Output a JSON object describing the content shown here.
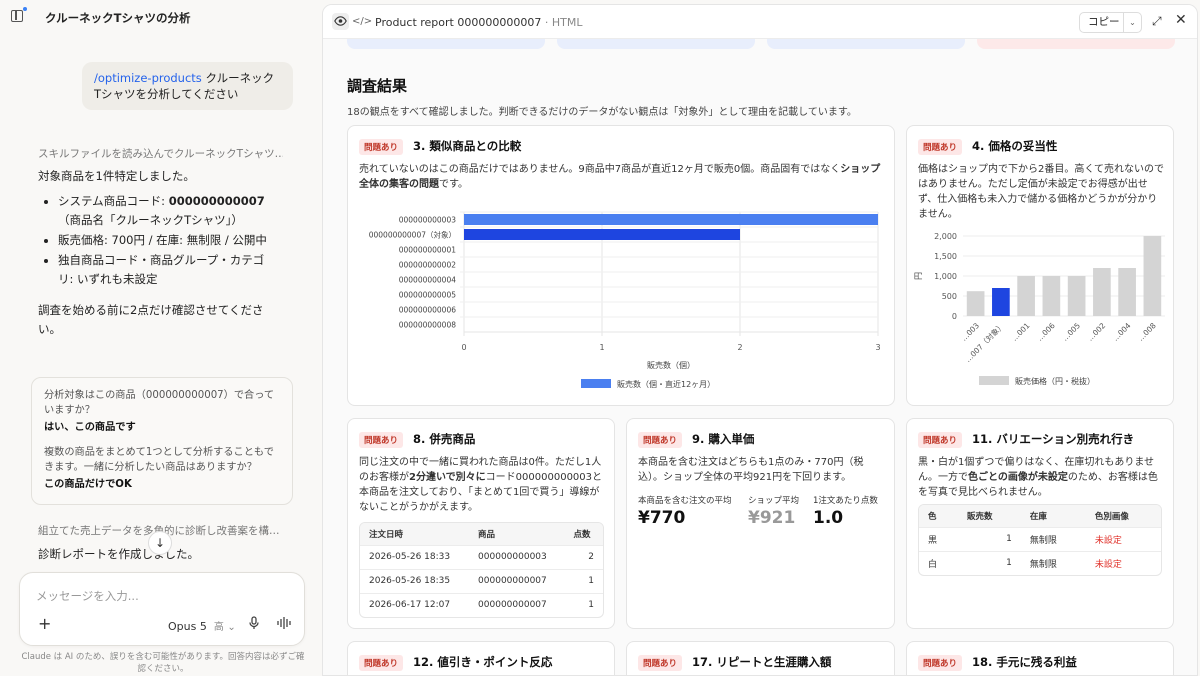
{
  "chat": {
    "title": "クルーネックTシャツの分析",
    "user_command": "/optimize-products",
    "user_text": " クルーネックTシャツを分析してください",
    "collapsed_1": "スキルファイルを読み込んでクルーネックTシャツ…",
    "intro": "対象商品を1件特定しました。",
    "b1_prefix": "システム商品コード: ",
    "b1_code": "000000000007",
    "b1_name": "（商品名「クルーネックTシャツ」）",
    "b2": "販売価格: 700円 / 在庫: 無制限 / 公開中",
    "b3": "独自商品コード・商品グループ・カテゴリ: いずれも未設定",
    "confirm": "調査を始める前に2点だけ確認させてください。",
    "q1": "分析対象はこの商品（000000000007）で合っていますか？",
    "a1": "はい、この商品です",
    "q2": "複数の商品をまとめて1つとして分析することもできます。一緒に分析したい商品はありますか？",
    "a2": "この商品だけでOK",
    "collapsed_2": "組立てた売上データを多角的に診断し改善案を構…",
    "report_done": "診断レポートを作成しました。",
    "scroll_icon": "↓",
    "placeholder": "メッセージを入力...",
    "plus_icon": "+",
    "model": "Opus 5",
    "model_level": "高",
    "mic_icon": "mic-icon",
    "voice_icon": "voice-icon",
    "disclaimer": "Claude は AI のため、誤りを含む可能性があります。回答内容は必ずご確認ください。"
  },
  "artifact": {
    "title": "Product report 000000000007",
    "title_type": " · HTML",
    "copy_label": "コピー",
    "strip_colors": [
      "#e8eefc",
      "#e8eefc",
      "#e8eefc",
      "#fde9e9"
    ],
    "section_title": "調査結果",
    "section_desc": "18の観点をすべて確認しました。判断できるだけのデータがない観点は「対象外」として理由を記載しています。",
    "badge": "問題あり",
    "card3": {
      "title": "3. 類似商品との比較",
      "body_1": "売れていないのはこの商品だけではありません。9商品中7商品が直近12ヶ月で販売0個。商品固有ではなく",
      "body_bold": "ショップ全体の集客の問題",
      "body_2": "です。"
    },
    "card4": {
      "title": "4. 価格の妥当性",
      "body": "価格はショップ内で下から2番目。高くて売れないのではありません。ただし定価が未設定でお得感が出せず、仕入価格も未入力で儲かる価格かどうかが分かりません。"
    },
    "card8": {
      "title": "8. 併売商品",
      "body_1": "同じ注文の中で一緒に買われた商品は0件。ただし1人のお客様が",
      "body_bold": "2分違いで別々に",
      "body_2": "コード000000000003と本商品を注文しており、「まとめて1回で買う」導線がないことがうかがえます。",
      "headers": [
        "注文日時",
        "商品",
        "点数"
      ],
      "rows": [
        [
          "2026-05-26 18:33",
          "000000000003",
          "2"
        ],
        [
          "2026-05-26 18:35",
          "000000000007",
          "1"
        ],
        [
          "2026-06-17 12:07",
          "000000000007",
          "1"
        ]
      ]
    },
    "card9": {
      "title": "9. 購入単価",
      "body": "本商品を含む注文はどちらも1点のみ・770円（税込）。ショップ全体の平均921円を下回ります。",
      "m1_label": "本商品を含む注文の平均",
      "m1_value": "¥770",
      "m2_label": "ショップ平均",
      "m2_value": "¥921",
      "m3_label": "1注文あたり点数",
      "m3_value": "1.0"
    },
    "card11": {
      "title": "11. バリエーション別売れ行き",
      "body_1": "黒・白が1個ずつで偏りはなく、在庫切れもありません。一方で",
      "body_bold": "色ごとの画像が未設定",
      "body_2": "のため、お客様は色を写真で見比べられません。",
      "headers": [
        "色",
        "販売数",
        "在庫",
        "色別画像"
      ],
      "rows": [
        [
          "黒",
          "1",
          "無制限",
          "未設定"
        ],
        [
          "白",
          "1",
          "無制限",
          "未設定"
        ]
      ]
    },
    "card12": {
      "title": "12. 値引き・ポイント反応"
    },
    "card17": {
      "title": "17. リピートと生涯購入額"
    },
    "card18": {
      "title": "18. 手元に残る利益"
    }
  },
  "chart_data": [
    {
      "type": "bar",
      "orientation": "horizontal",
      "categories": [
        "000000000003",
        "000000000007（対象）",
        "000000000001",
        "000000000002",
        "000000000004",
        "000000000005",
        "000000000006",
        "000000000008"
      ],
      "series": [
        {
          "name": "販売数（個・直近12ヶ月）",
          "values": [
            3,
            2,
            0,
            0,
            0,
            0,
            0,
            0
          ]
        }
      ],
      "highlight_index": 1,
      "xlabel": "販売数（個）",
      "xlim": [
        0,
        3
      ],
      "xticks": [
        "0",
        "1",
        "2",
        "3"
      ],
      "colors": {
        "bar": "#4a7ff0",
        "highlight": "#1e45e0"
      },
      "grid": true,
      "legend": "bottom"
    },
    {
      "type": "bar",
      "categories": [
        "…003",
        "…007（対象）",
        "…001",
        "…006",
        "…005",
        "…002",
        "…004",
        "…008"
      ],
      "series": [
        {
          "name": "販売価格（円・税抜）",
          "values": [
            620,
            700,
            1000,
            1000,
            1000,
            1200,
            1200,
            2000
          ]
        }
      ],
      "highlight_index": 1,
      "ylabel": "円",
      "ylim": [
        0,
        2000
      ],
      "yticks": [
        "0",
        "500",
        "1,000",
        "1,500",
        "2,000"
      ],
      "colors": {
        "bar": "#d4d4d4",
        "highlight": "#1e45e0"
      },
      "grid": true,
      "legend": "bottom"
    }
  ]
}
